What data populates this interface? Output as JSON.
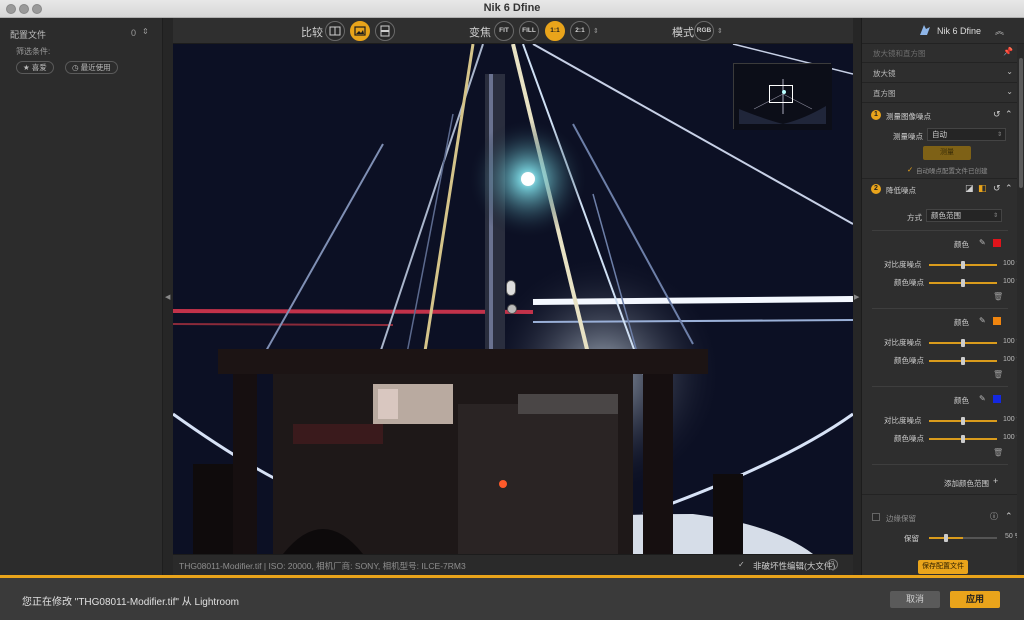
{
  "window": {
    "title": "Nik 6 Dfine"
  },
  "left_panel": {
    "header": "配置文件",
    "count": "0",
    "filter_label": "筛选条件:",
    "chips": [
      "★ 喜爱",
      "◷ 最近使用"
    ]
  },
  "toolbar": {
    "compare_label": "比较",
    "zoom_label": "变焦",
    "zoom_buttons": [
      "FIT",
      "FILL",
      "1:1",
      "2:1"
    ],
    "zoom_active": "1:1",
    "mode_label": "模式",
    "mode_button": "RGB"
  },
  "status": {
    "info": "THG08011-Modifier.tif   |   ISO: 20000,  相机厂商: SONY,  相机型号: ILCE-7RM3",
    "non_destructive": "非破坏性编辑(大文件)",
    "non_destructive_checked": true,
    "help": "?"
  },
  "right_panel": {
    "brand": "Nik 6 Dfine",
    "loupe_row": "放大镜和直方图",
    "loupe": "放大镜",
    "histogram": "直方图",
    "step1": {
      "number": "1",
      "title": "测量图像噪点",
      "method_label": "测量噪点",
      "method_value": "自动",
      "measure_button": "测量",
      "auto_note": "自动噪点配置文件已创建"
    },
    "step2": {
      "number": "2",
      "title": "降低噪点",
      "method_label": "方式",
      "method_value": "颜色范围",
      "color_ranges": [
        {
          "color_label": "颜色",
          "swatch": "#e0141b",
          "contrast_label": "对比度噪点",
          "contrast_value": "100 %",
          "contrast_level": 1.0,
          "color_noise_label": "颜色噪点",
          "color_noise_value": "100 %",
          "color_noise_level": 1.0
        },
        {
          "color_label": "颜色",
          "swatch": "#f0850f",
          "contrast_label": "对比度噪点",
          "contrast_value": "100 %",
          "contrast_level": 1.0,
          "color_noise_label": "颜色噪点",
          "color_noise_value": "100 %",
          "color_noise_level": 1.0
        },
        {
          "color_label": "颜色",
          "swatch": "#1428e0",
          "contrast_label": "对比度噪点",
          "contrast_value": "100 %",
          "contrast_level": 1.0,
          "color_noise_label": "颜色噪点",
          "color_noise_value": "100 %",
          "color_noise_level": 1.0
        }
      ],
      "add_range": "添加颜色范围"
    },
    "edge": {
      "title": "边缘保留",
      "keep_label": "保留",
      "keep_value": "50 %",
      "keep_level": 0.5
    },
    "save_profile": "保存配置文件"
  },
  "bottom": {
    "message": "您正在修改 \"THG08011-Modifier.tif\" 从 Lightroom",
    "cancel": "取消",
    "apply": "应用"
  },
  "colors": {
    "accent": "#e9a41b"
  }
}
